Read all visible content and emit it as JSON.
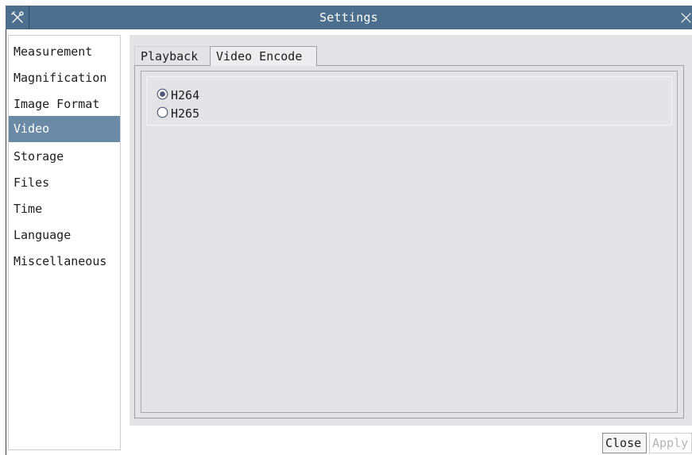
{
  "window": {
    "title": "Settings",
    "app_icon": "tools-icon",
    "close_icon": "close-icon"
  },
  "sidebar": {
    "selected": "Video",
    "items": [
      {
        "label": "Measurement"
      },
      {
        "label": "Magnification"
      },
      {
        "label": "Image Format"
      },
      {
        "label": "Video"
      },
      {
        "label": "Storage"
      },
      {
        "label": "Files"
      },
      {
        "label": "Time"
      },
      {
        "label": "Language"
      },
      {
        "label": "Miscellaneous"
      }
    ]
  },
  "tabs": {
    "items": [
      {
        "label": "Playback"
      },
      {
        "label": "Video Encode"
      }
    ],
    "active": "Video Encode"
  },
  "encode": {
    "options": [
      {
        "label": "H264",
        "checked": true
      },
      {
        "label": "H265",
        "checked": false
      }
    ]
  },
  "footer": {
    "close_label": "Close",
    "apply_label": "Apply",
    "apply_enabled": false
  },
  "colors": {
    "titlebar": "#4b6f8d",
    "selected_item": "#6a8aa6",
    "panel": "#e4e4e6",
    "disabled_text": "#b4b4b4"
  }
}
